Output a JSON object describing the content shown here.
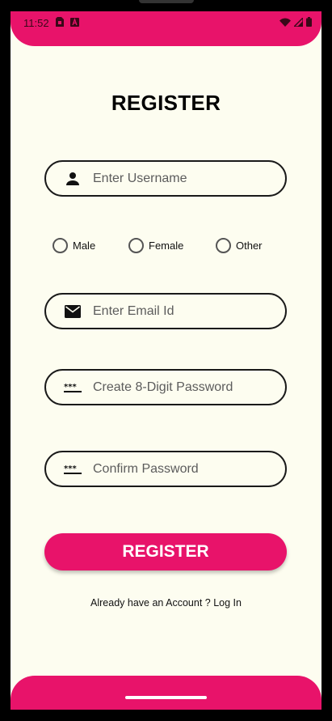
{
  "status_bar": {
    "time": "11:52"
  },
  "title": "REGISTER",
  "username": {
    "placeholder": "Enter Username",
    "value": "",
    "icon": "person-icon"
  },
  "gender": {
    "options": [
      "Male",
      "Female",
      "Other"
    ]
  },
  "email": {
    "placeholder": "Enter Email Id",
    "value": "",
    "icon": "mail-icon"
  },
  "password": {
    "placeholder": "Create 8-Digit Password",
    "value": "",
    "icon": "password-dots-icon"
  },
  "confirm_password": {
    "placeholder": "Confirm Password",
    "value": "",
    "icon": "password-dots-icon"
  },
  "register_button": "REGISTER",
  "login_prompt": {
    "text": "Already have an Account ? ",
    "link": "Log In"
  },
  "colors": {
    "accent": "#e8136a",
    "background": "#fdfdf0"
  }
}
